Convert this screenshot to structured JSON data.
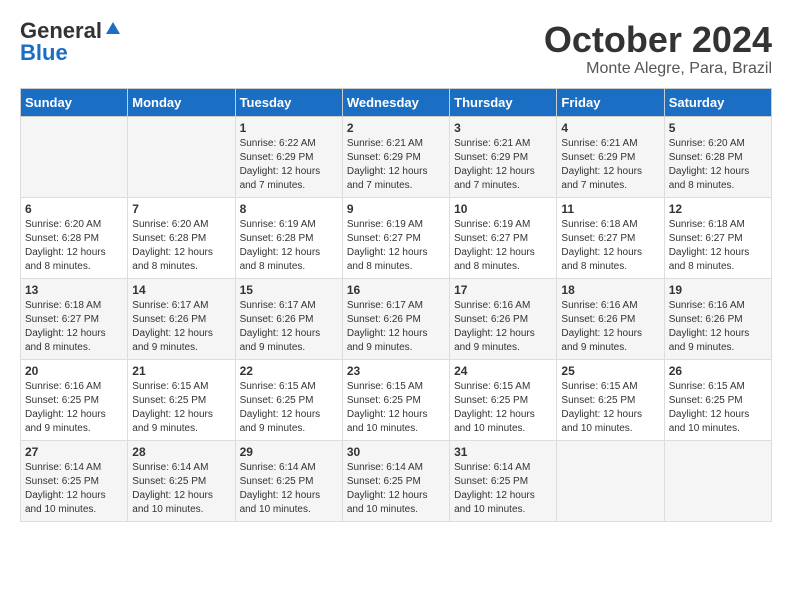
{
  "logo": {
    "general": "General",
    "blue": "Blue"
  },
  "title": {
    "month": "October 2024",
    "location": "Monte Alegre, Para, Brazil"
  },
  "weekdays": [
    "Sunday",
    "Monday",
    "Tuesday",
    "Wednesday",
    "Thursday",
    "Friday",
    "Saturday"
  ],
  "weeks": [
    [
      {
        "day": "",
        "sunrise": "",
        "sunset": "",
        "daylight": ""
      },
      {
        "day": "",
        "sunrise": "",
        "sunset": "",
        "daylight": ""
      },
      {
        "day": "1",
        "sunrise": "Sunrise: 6:22 AM",
        "sunset": "Sunset: 6:29 PM",
        "daylight": "Daylight: 12 hours and 7 minutes."
      },
      {
        "day": "2",
        "sunrise": "Sunrise: 6:21 AM",
        "sunset": "Sunset: 6:29 PM",
        "daylight": "Daylight: 12 hours and 7 minutes."
      },
      {
        "day": "3",
        "sunrise": "Sunrise: 6:21 AM",
        "sunset": "Sunset: 6:29 PM",
        "daylight": "Daylight: 12 hours and 7 minutes."
      },
      {
        "day": "4",
        "sunrise": "Sunrise: 6:21 AM",
        "sunset": "Sunset: 6:29 PM",
        "daylight": "Daylight: 12 hours and 7 minutes."
      },
      {
        "day": "5",
        "sunrise": "Sunrise: 6:20 AM",
        "sunset": "Sunset: 6:28 PM",
        "daylight": "Daylight: 12 hours and 8 minutes."
      }
    ],
    [
      {
        "day": "6",
        "sunrise": "Sunrise: 6:20 AM",
        "sunset": "Sunset: 6:28 PM",
        "daylight": "Daylight: 12 hours and 8 minutes."
      },
      {
        "day": "7",
        "sunrise": "Sunrise: 6:20 AM",
        "sunset": "Sunset: 6:28 PM",
        "daylight": "Daylight: 12 hours and 8 minutes."
      },
      {
        "day": "8",
        "sunrise": "Sunrise: 6:19 AM",
        "sunset": "Sunset: 6:28 PM",
        "daylight": "Daylight: 12 hours and 8 minutes."
      },
      {
        "day": "9",
        "sunrise": "Sunrise: 6:19 AM",
        "sunset": "Sunset: 6:27 PM",
        "daylight": "Daylight: 12 hours and 8 minutes."
      },
      {
        "day": "10",
        "sunrise": "Sunrise: 6:19 AM",
        "sunset": "Sunset: 6:27 PM",
        "daylight": "Daylight: 12 hours and 8 minutes."
      },
      {
        "day": "11",
        "sunrise": "Sunrise: 6:18 AM",
        "sunset": "Sunset: 6:27 PM",
        "daylight": "Daylight: 12 hours and 8 minutes."
      },
      {
        "day": "12",
        "sunrise": "Sunrise: 6:18 AM",
        "sunset": "Sunset: 6:27 PM",
        "daylight": "Daylight: 12 hours and 8 minutes."
      }
    ],
    [
      {
        "day": "13",
        "sunrise": "Sunrise: 6:18 AM",
        "sunset": "Sunset: 6:27 PM",
        "daylight": "Daylight: 12 hours and 8 minutes."
      },
      {
        "day": "14",
        "sunrise": "Sunrise: 6:17 AM",
        "sunset": "Sunset: 6:26 PM",
        "daylight": "Daylight: 12 hours and 9 minutes."
      },
      {
        "day": "15",
        "sunrise": "Sunrise: 6:17 AM",
        "sunset": "Sunset: 6:26 PM",
        "daylight": "Daylight: 12 hours and 9 minutes."
      },
      {
        "day": "16",
        "sunrise": "Sunrise: 6:17 AM",
        "sunset": "Sunset: 6:26 PM",
        "daylight": "Daylight: 12 hours and 9 minutes."
      },
      {
        "day": "17",
        "sunrise": "Sunrise: 6:16 AM",
        "sunset": "Sunset: 6:26 PM",
        "daylight": "Daylight: 12 hours and 9 minutes."
      },
      {
        "day": "18",
        "sunrise": "Sunrise: 6:16 AM",
        "sunset": "Sunset: 6:26 PM",
        "daylight": "Daylight: 12 hours and 9 minutes."
      },
      {
        "day": "19",
        "sunrise": "Sunrise: 6:16 AM",
        "sunset": "Sunset: 6:26 PM",
        "daylight": "Daylight: 12 hours and 9 minutes."
      }
    ],
    [
      {
        "day": "20",
        "sunrise": "Sunrise: 6:16 AM",
        "sunset": "Sunset: 6:25 PM",
        "daylight": "Daylight: 12 hours and 9 minutes."
      },
      {
        "day": "21",
        "sunrise": "Sunrise: 6:15 AM",
        "sunset": "Sunset: 6:25 PM",
        "daylight": "Daylight: 12 hours and 9 minutes."
      },
      {
        "day": "22",
        "sunrise": "Sunrise: 6:15 AM",
        "sunset": "Sunset: 6:25 PM",
        "daylight": "Daylight: 12 hours and 9 minutes."
      },
      {
        "day": "23",
        "sunrise": "Sunrise: 6:15 AM",
        "sunset": "Sunset: 6:25 PM",
        "daylight": "Daylight: 12 hours and 10 minutes."
      },
      {
        "day": "24",
        "sunrise": "Sunrise: 6:15 AM",
        "sunset": "Sunset: 6:25 PM",
        "daylight": "Daylight: 12 hours and 10 minutes."
      },
      {
        "day": "25",
        "sunrise": "Sunrise: 6:15 AM",
        "sunset": "Sunset: 6:25 PM",
        "daylight": "Daylight: 12 hours and 10 minutes."
      },
      {
        "day": "26",
        "sunrise": "Sunrise: 6:15 AM",
        "sunset": "Sunset: 6:25 PM",
        "daylight": "Daylight: 12 hours and 10 minutes."
      }
    ],
    [
      {
        "day": "27",
        "sunrise": "Sunrise: 6:14 AM",
        "sunset": "Sunset: 6:25 PM",
        "daylight": "Daylight: 12 hours and 10 minutes."
      },
      {
        "day": "28",
        "sunrise": "Sunrise: 6:14 AM",
        "sunset": "Sunset: 6:25 PM",
        "daylight": "Daylight: 12 hours and 10 minutes."
      },
      {
        "day": "29",
        "sunrise": "Sunrise: 6:14 AM",
        "sunset": "Sunset: 6:25 PM",
        "daylight": "Daylight: 12 hours and 10 minutes."
      },
      {
        "day": "30",
        "sunrise": "Sunrise: 6:14 AM",
        "sunset": "Sunset: 6:25 PM",
        "daylight": "Daylight: 12 hours and 10 minutes."
      },
      {
        "day": "31",
        "sunrise": "Sunrise: 6:14 AM",
        "sunset": "Sunset: 6:25 PM",
        "daylight": "Daylight: 12 hours and 10 minutes."
      },
      {
        "day": "",
        "sunrise": "",
        "sunset": "",
        "daylight": ""
      },
      {
        "day": "",
        "sunrise": "",
        "sunset": "",
        "daylight": ""
      }
    ]
  ]
}
